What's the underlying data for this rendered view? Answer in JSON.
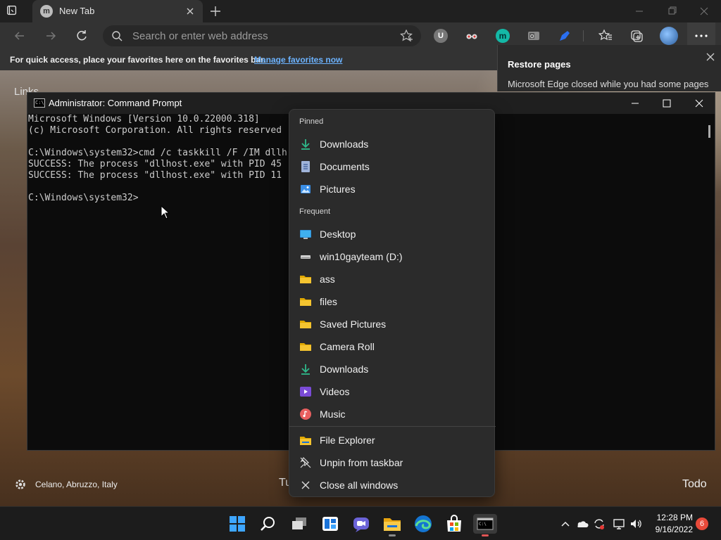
{
  "browser": {
    "tab_title": "New Tab",
    "favicon_letter": "m",
    "address_placeholder": "Search or enter web address",
    "favbar_text": "For quick access, place your favorites here on the favorites bar.",
    "favbar_link": "Manage favorites now",
    "extensions": [
      "ublock-icon",
      "spy-glasses-icon",
      "m-extension-icon",
      "outlook-extension-icon",
      "pen-extension-icon"
    ],
    "restore": {
      "title": "Restore pages",
      "message": "Microsoft Edge closed while you had some pages"
    }
  },
  "newtab": {
    "link_text": "Links",
    "location": "Celano, Abruzzo, Italy",
    "partial_text": "Tu",
    "todo": "Todo"
  },
  "cmd": {
    "title": "Administrator: Command Prompt",
    "lines": [
      "Microsoft Windows [Version 10.0.22000.318]",
      "(c) Microsoft Corporation. All rights reserved",
      "",
      "C:\\Windows\\system32>cmd /c taskkill /F /IM dllh",
      "SUCCESS: The process \"dllhost.exe\" with PID 45",
      "SUCCESS: The process \"dllhost.exe\" with PID 11",
      "",
      "C:\\Windows\\system32>"
    ]
  },
  "jumplist": {
    "pinned_header": "Pinned",
    "pinned": [
      {
        "label": "Downloads",
        "icon": "download-icon"
      },
      {
        "label": "Documents",
        "icon": "documents-icon"
      },
      {
        "label": "Pictures",
        "icon": "pictures-icon"
      }
    ],
    "frequent_header": "Frequent",
    "frequent": [
      {
        "label": "Desktop",
        "icon": "desktop-icon"
      },
      {
        "label": "win10gayteam (D:)",
        "icon": "drive-icon"
      },
      {
        "label": "ass",
        "icon": "folder-icon"
      },
      {
        "label": "files",
        "icon": "folder-icon"
      },
      {
        "label": "Saved Pictures",
        "icon": "folder-icon"
      },
      {
        "label": "Camera Roll",
        "icon": "folder-icon"
      },
      {
        "label": "Downloads",
        "icon": "download-icon"
      },
      {
        "label": "Videos",
        "icon": "videos-icon"
      },
      {
        "label": "Music",
        "icon": "music-icon"
      }
    ],
    "tasks": [
      {
        "label": "File Explorer",
        "icon": "file-explorer-icon"
      },
      {
        "label": "Unpin from taskbar",
        "icon": "unpin-icon"
      },
      {
        "label": "Close all windows",
        "icon": "close-icon"
      }
    ]
  },
  "taskbar": {
    "apps": [
      "start-icon",
      "search-icon",
      "task-view-icon",
      "widgets-icon",
      "chat-icon",
      "file-explorer-icon",
      "edge-icon",
      "store-icon",
      "terminal-icon"
    ],
    "time": "12:28 PM",
    "date": "9/16/2022",
    "notifications": "6"
  },
  "colors": {
    "accent_link": "#6cb3ff",
    "folder": "#f4c430",
    "download": "#2fb88a",
    "notification_badge": "#e84a3a"
  }
}
